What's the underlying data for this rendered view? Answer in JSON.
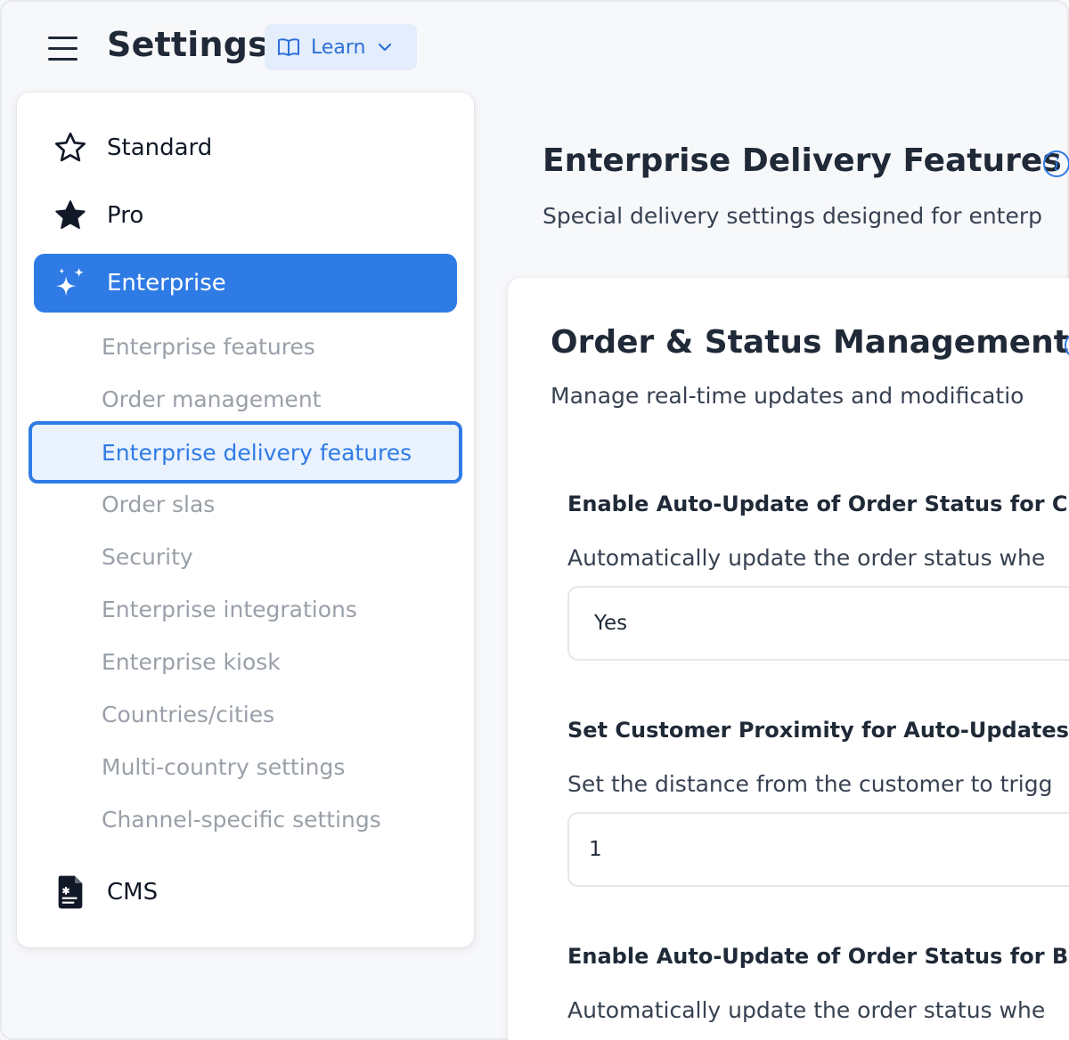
{
  "header": {
    "title": "Settings",
    "learn_label": "Learn"
  },
  "sidebar": {
    "items": [
      {
        "label": "Standard",
        "icon": "star-outline-icon"
      },
      {
        "label": "Pro",
        "icon": "star-filled-icon"
      },
      {
        "label": "Enterprise",
        "icon": "sparkles-icon",
        "active": true
      },
      {
        "label": "CMS",
        "icon": "document-icon"
      }
    ],
    "sub_items": [
      "Enterprise features",
      "Order management",
      "Enterprise delivery features",
      "Order slas",
      "Security",
      "Enterprise integrations",
      "Enterprise kiosk",
      "Countries/cities",
      "Multi-country settings",
      "Channel-specific settings"
    ]
  },
  "main": {
    "title": "Enterprise Delivery Features",
    "subtitle": "Special delivery settings designed for enterp",
    "section": {
      "title": "Order & Status Management",
      "subtitle": "Manage real-time updates and modificatio",
      "fields": [
        {
          "label": "Enable Auto-Update of Order Status for Cu",
          "description": "Automatically update the order status whe",
          "value": "Yes"
        },
        {
          "label": "Set Customer Proximity for Auto-Updates",
          "description": "Set the distance from the customer to trigg",
          "value": "1"
        },
        {
          "label": "Enable Auto-Update of Order Status for Bu",
          "description": "Automatically update the order status whe"
        }
      ]
    }
  },
  "colors": {
    "accent": "#2f7be5",
    "accent_light": "#eaf2fd",
    "learn_bg": "#e3edfb",
    "muted_text": "#9aa0a8"
  }
}
